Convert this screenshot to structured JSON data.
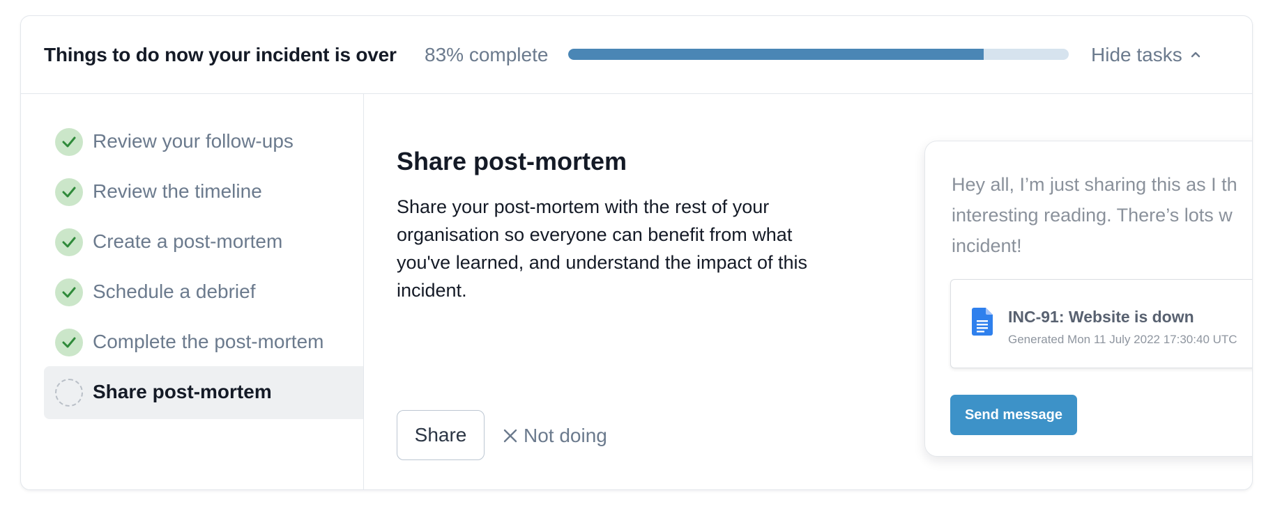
{
  "header": {
    "title": "Things to do now your incident is over",
    "progress_text": "83% complete",
    "progress_value": 0.83,
    "hide_tasks_label": "Hide tasks",
    "hide_tasks_icon": "chevron-up-icon"
  },
  "tasks": [
    {
      "label": "Review your follow-ups",
      "status": "done",
      "icon": "check-circle-icon"
    },
    {
      "label": "Review the timeline",
      "status": "done",
      "icon": "check-circle-icon"
    },
    {
      "label": "Create a post-mortem",
      "status": "done",
      "icon": "check-circle-icon"
    },
    {
      "label": "Schedule a debrief",
      "status": "done",
      "icon": "check-circle-icon"
    },
    {
      "label": "Complete the post-mortem",
      "status": "done",
      "icon": "check-circle-icon"
    },
    {
      "label": "Share post-mortem",
      "status": "todo",
      "icon": "dashed-circle-icon",
      "selected": true
    }
  ],
  "main": {
    "title": "Share post-mortem",
    "description": "Share your post-mortem with the rest of your organisation so everyone can benefit from what you've learned, and understand the impact of this incident.",
    "share_label": "Share",
    "not_doing_label": "Not doing",
    "not_doing_icon": "close-icon"
  },
  "preview": {
    "message_lines": [
      "Hey all, I’m just sharing this as I th",
      "interesting reading. There’s lots w",
      "incident!"
    ],
    "doc_title": "INC-91: Website is down",
    "doc_subtitle": "Generated Mon 11 July 2022 17:30:40 UTC",
    "doc_icon": "google-doc-icon",
    "send_label": "Send message"
  },
  "colors": {
    "accent": "#4a86b5",
    "progress_track": "#d6e3ee",
    "success_bg": "#cbe6c9",
    "success_check": "#2f8a3a",
    "send_button": "#3d92c8",
    "doc_blue": "#2f80ed"
  }
}
